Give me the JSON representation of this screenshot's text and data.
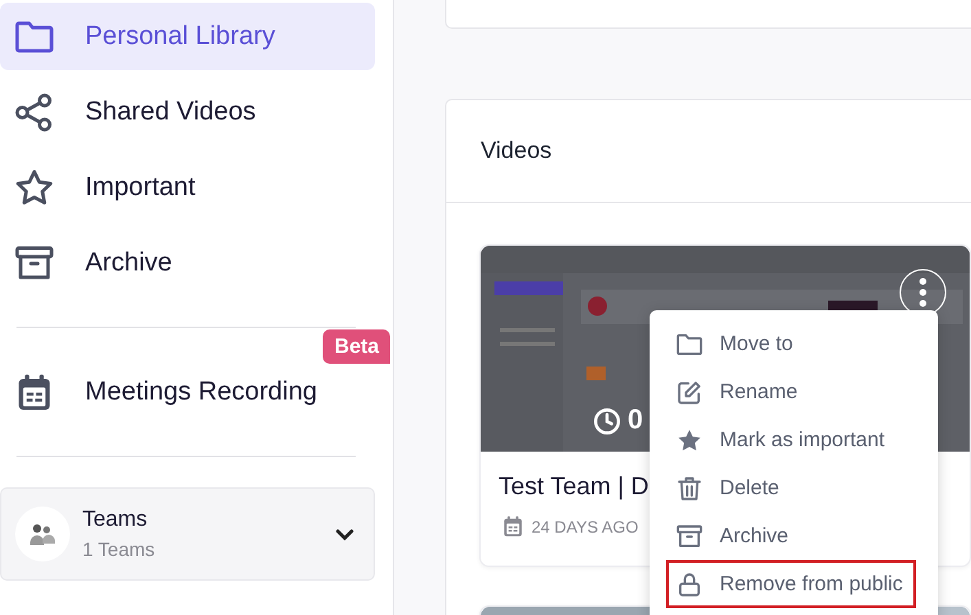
{
  "sidebar": {
    "sections": [
      {
        "items": [
          {
            "label": "Personal Library",
            "selected": true
          },
          {
            "label": "Shared Videos",
            "selected": false
          },
          {
            "label": "Important",
            "selected": false
          },
          {
            "label": "Archive",
            "selected": false
          }
        ]
      },
      {
        "items": [
          {
            "label": "Meetings Recording",
            "selected": false,
            "badge": "Beta"
          }
        ]
      }
    ],
    "teams": {
      "title": "Teams",
      "subtitle": "1 Teams",
      "expanded": false
    }
  },
  "videos_panel": {
    "title": "Videos",
    "videos": [
      {
        "kind": "picture",
        "title": "Test Team | D",
        "date": "24 DAYS AGO",
        "duration": "0"
      },
      {
        "kind": "picture"
      }
    ]
  },
  "context_menu": {
    "items": [
      {
        "label": "Move to",
        "highlighted": false
      },
      {
        "label": "Rename",
        "highlighted": false
      },
      {
        "label": "Mark as important",
        "highlighted": false
      },
      {
        "label": "Delete",
        "highlighted": false
      },
      {
        "label": "Archive",
        "highlighted": false
      },
      {
        "label": "Remove from public",
        "highlighted": true
      }
    ]
  }
}
